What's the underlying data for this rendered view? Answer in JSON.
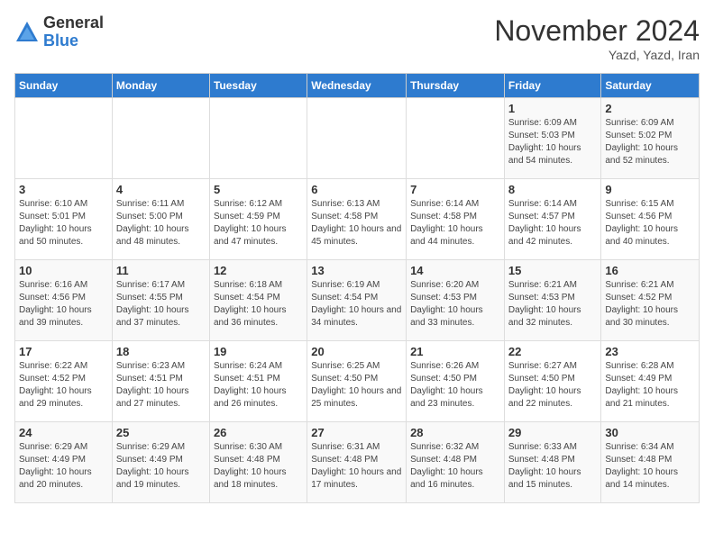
{
  "logo": {
    "general": "General",
    "blue": "Blue"
  },
  "title": "November 2024",
  "subtitle": "Yazd, Yazd, Iran",
  "days_of_week": [
    "Sunday",
    "Monday",
    "Tuesday",
    "Wednesday",
    "Thursday",
    "Friday",
    "Saturday"
  ],
  "weeks": [
    [
      {
        "day": "",
        "info": ""
      },
      {
        "day": "",
        "info": ""
      },
      {
        "day": "",
        "info": ""
      },
      {
        "day": "",
        "info": ""
      },
      {
        "day": "",
        "info": ""
      },
      {
        "day": "1",
        "info": "Sunrise: 6:09 AM\nSunset: 5:03 PM\nDaylight: 10 hours and 54 minutes."
      },
      {
        "day": "2",
        "info": "Sunrise: 6:09 AM\nSunset: 5:02 PM\nDaylight: 10 hours and 52 minutes."
      }
    ],
    [
      {
        "day": "3",
        "info": "Sunrise: 6:10 AM\nSunset: 5:01 PM\nDaylight: 10 hours and 50 minutes."
      },
      {
        "day": "4",
        "info": "Sunrise: 6:11 AM\nSunset: 5:00 PM\nDaylight: 10 hours and 48 minutes."
      },
      {
        "day": "5",
        "info": "Sunrise: 6:12 AM\nSunset: 4:59 PM\nDaylight: 10 hours and 47 minutes."
      },
      {
        "day": "6",
        "info": "Sunrise: 6:13 AM\nSunset: 4:58 PM\nDaylight: 10 hours and 45 minutes."
      },
      {
        "day": "7",
        "info": "Sunrise: 6:14 AM\nSunset: 4:58 PM\nDaylight: 10 hours and 44 minutes."
      },
      {
        "day": "8",
        "info": "Sunrise: 6:14 AM\nSunset: 4:57 PM\nDaylight: 10 hours and 42 minutes."
      },
      {
        "day": "9",
        "info": "Sunrise: 6:15 AM\nSunset: 4:56 PM\nDaylight: 10 hours and 40 minutes."
      }
    ],
    [
      {
        "day": "10",
        "info": "Sunrise: 6:16 AM\nSunset: 4:56 PM\nDaylight: 10 hours and 39 minutes."
      },
      {
        "day": "11",
        "info": "Sunrise: 6:17 AM\nSunset: 4:55 PM\nDaylight: 10 hours and 37 minutes."
      },
      {
        "day": "12",
        "info": "Sunrise: 6:18 AM\nSunset: 4:54 PM\nDaylight: 10 hours and 36 minutes."
      },
      {
        "day": "13",
        "info": "Sunrise: 6:19 AM\nSunset: 4:54 PM\nDaylight: 10 hours and 34 minutes."
      },
      {
        "day": "14",
        "info": "Sunrise: 6:20 AM\nSunset: 4:53 PM\nDaylight: 10 hours and 33 minutes."
      },
      {
        "day": "15",
        "info": "Sunrise: 6:21 AM\nSunset: 4:53 PM\nDaylight: 10 hours and 32 minutes."
      },
      {
        "day": "16",
        "info": "Sunrise: 6:21 AM\nSunset: 4:52 PM\nDaylight: 10 hours and 30 minutes."
      }
    ],
    [
      {
        "day": "17",
        "info": "Sunrise: 6:22 AM\nSunset: 4:52 PM\nDaylight: 10 hours and 29 minutes."
      },
      {
        "day": "18",
        "info": "Sunrise: 6:23 AM\nSunset: 4:51 PM\nDaylight: 10 hours and 27 minutes."
      },
      {
        "day": "19",
        "info": "Sunrise: 6:24 AM\nSunset: 4:51 PM\nDaylight: 10 hours and 26 minutes."
      },
      {
        "day": "20",
        "info": "Sunrise: 6:25 AM\nSunset: 4:50 PM\nDaylight: 10 hours and 25 minutes."
      },
      {
        "day": "21",
        "info": "Sunrise: 6:26 AM\nSunset: 4:50 PM\nDaylight: 10 hours and 23 minutes."
      },
      {
        "day": "22",
        "info": "Sunrise: 6:27 AM\nSunset: 4:50 PM\nDaylight: 10 hours and 22 minutes."
      },
      {
        "day": "23",
        "info": "Sunrise: 6:28 AM\nSunset: 4:49 PM\nDaylight: 10 hours and 21 minutes."
      }
    ],
    [
      {
        "day": "24",
        "info": "Sunrise: 6:29 AM\nSunset: 4:49 PM\nDaylight: 10 hours and 20 minutes."
      },
      {
        "day": "25",
        "info": "Sunrise: 6:29 AM\nSunset: 4:49 PM\nDaylight: 10 hours and 19 minutes."
      },
      {
        "day": "26",
        "info": "Sunrise: 6:30 AM\nSunset: 4:48 PM\nDaylight: 10 hours and 18 minutes."
      },
      {
        "day": "27",
        "info": "Sunrise: 6:31 AM\nSunset: 4:48 PM\nDaylight: 10 hours and 17 minutes."
      },
      {
        "day": "28",
        "info": "Sunrise: 6:32 AM\nSunset: 4:48 PM\nDaylight: 10 hours and 16 minutes."
      },
      {
        "day": "29",
        "info": "Sunrise: 6:33 AM\nSunset: 4:48 PM\nDaylight: 10 hours and 15 minutes."
      },
      {
        "day": "30",
        "info": "Sunrise: 6:34 AM\nSunset: 4:48 PM\nDaylight: 10 hours and 14 minutes."
      }
    ]
  ]
}
